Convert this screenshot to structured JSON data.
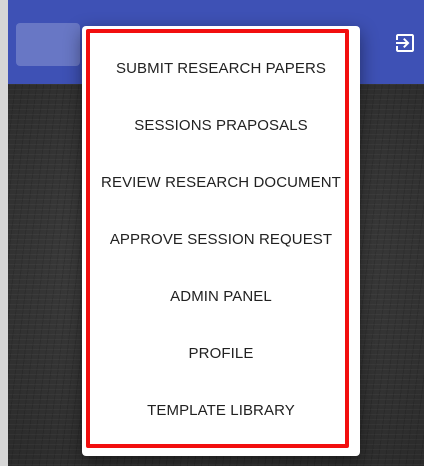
{
  "menu": {
    "items": [
      {
        "label": "SUBMIT RESEARCH PAPERS"
      },
      {
        "label": "SESSIONS PRAPOSALS"
      },
      {
        "label": "REVIEW RESEARCH DOCUMENT"
      },
      {
        "label": "APPROVE SESSION REQUEST"
      },
      {
        "label": "ADMIN PANEL"
      },
      {
        "label": "PROFILE"
      },
      {
        "label": "TEMPLATE LIBRARY"
      }
    ]
  },
  "header": {
    "logout_icon": "exit-to-app-icon"
  },
  "colors": {
    "app_bar": "#3e51b5",
    "highlight": "#f20e0e",
    "menu_bg": "#ffffff",
    "text": "#212121"
  }
}
